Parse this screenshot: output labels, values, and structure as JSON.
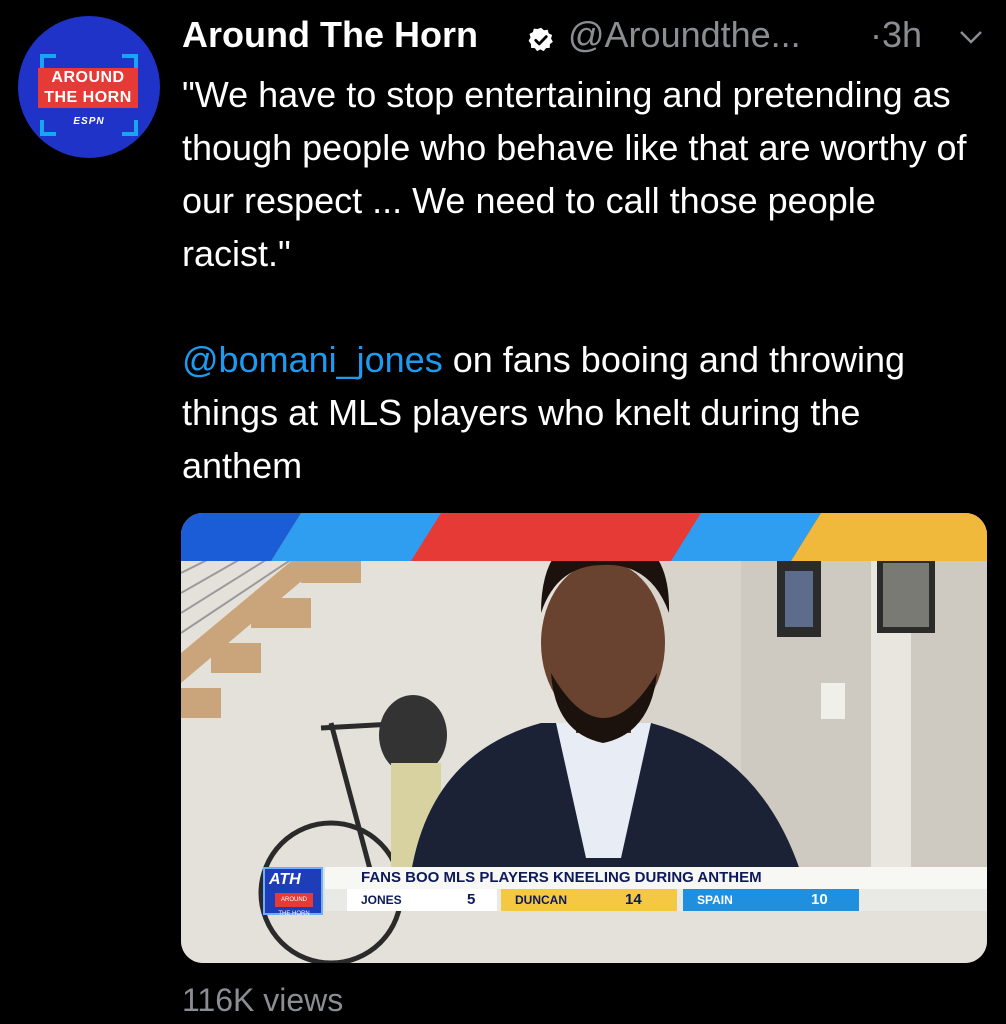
{
  "account": {
    "display_name": "Around The Horn",
    "handle": "@Aroundthe...",
    "timestamp": "·3h",
    "verified_icon": "verified-badge-icon",
    "avatar": {
      "logo_line1": "AROUND",
      "logo_line2": "THE HORN",
      "brand": "ESPN"
    }
  },
  "tweet": {
    "quote": "\"We have to stop entertaining and pretending as though people who behave like that are worthy of our respect ... We need to call those people racist.\"",
    "mention": "@bomani_jones",
    "rest": " on fans booing and throwing things at MLS players who knelt during the anthem"
  },
  "media": {
    "bug_label": "ATH",
    "bug_mini": "AROUND THE HORN",
    "headline": "FANS BOO MLS PLAYERS KNEELING DURING ANTHEM",
    "scores": [
      {
        "name": "JONES",
        "value": "5"
      },
      {
        "name": "DUNCAN",
        "value": "14"
      },
      {
        "name": "SPAIN",
        "value": "10"
      }
    ]
  },
  "stats": {
    "views": "116K views"
  },
  "colors": {
    "background": "#000000",
    "link": "#1d9bf0",
    "muted": "#8a8d91",
    "avatar_blue": "#1f33c9",
    "brand_red": "#e63a36"
  }
}
